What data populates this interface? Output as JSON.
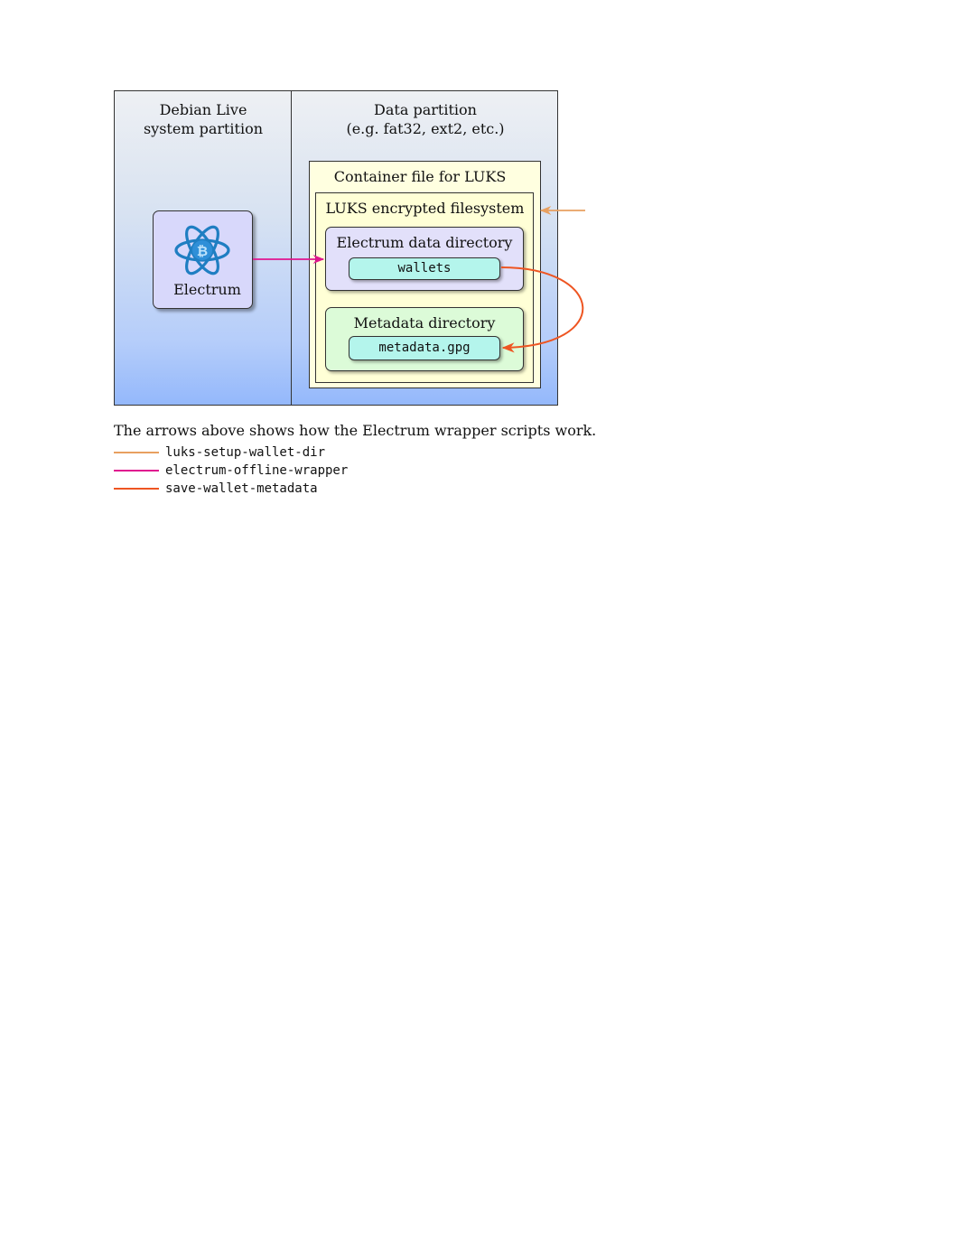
{
  "diagram": {
    "system_partition": {
      "line1": "Debian Live",
      "line2": "system partition"
    },
    "data_partition": {
      "line1": "Data partition",
      "line2": "(e.g. fat32, ext2, etc.)"
    },
    "electrum": {
      "label": "Electrum",
      "icon": "electrum-bitcoin-atom-icon"
    },
    "container_label": "Container file for LUKS",
    "luks_label": "LUKS encrypted filesystem",
    "electrum_dir_label": "Electrum data directory",
    "wallets_file": "wallets",
    "metadata_dir_label": "Metadata directory",
    "metadata_file": "metadata.gpg",
    "colors": {
      "luks_setup": "#e8a060",
      "offline_wrapper": "#e0168f",
      "save_metadata": "#ee5522"
    }
  },
  "caption": "The arrows above shows how the Electrum wrapper scripts work.",
  "legend": [
    {
      "script": "luks-setup-wallet-dir",
      "color": "#e8a060"
    },
    {
      "script": "electrum-offline-wrapper",
      "color": "#e0168f"
    },
    {
      "script": "save-wallet-metadata",
      "color": "#ee5522"
    }
  ]
}
